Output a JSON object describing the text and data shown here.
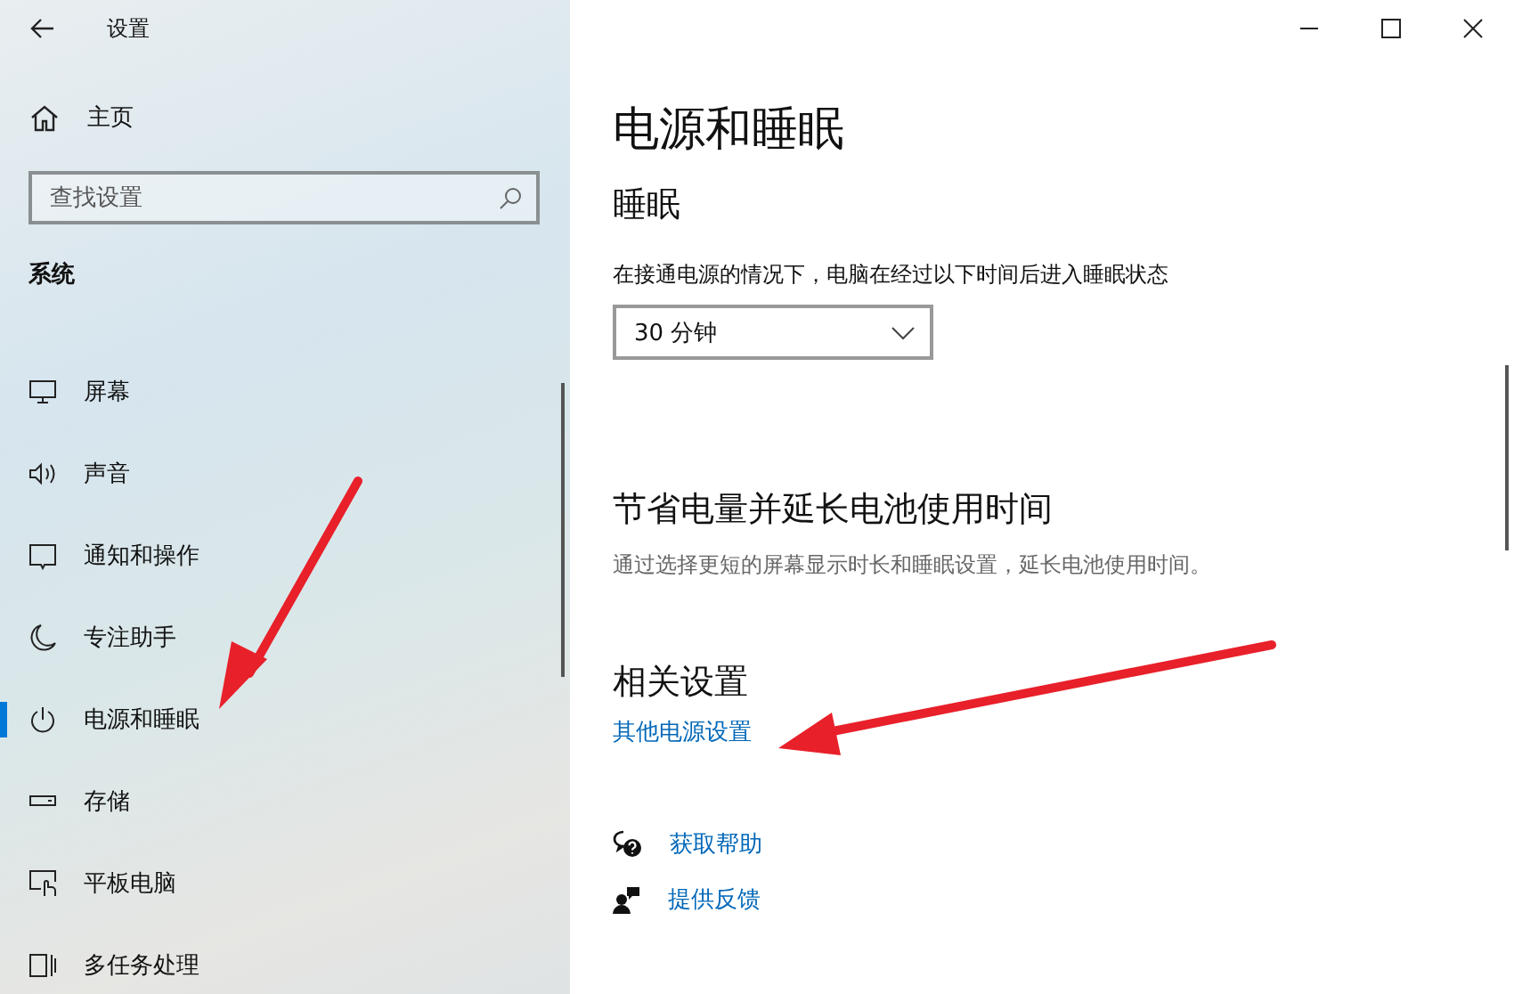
{
  "window": {
    "title": "设置"
  },
  "sidebar": {
    "home": "主页",
    "search": {
      "placeholder": "查找设置"
    },
    "section": "系统",
    "items": [
      {
        "label": "屏幕",
        "kind": "display",
        "selected": false
      },
      {
        "label": "声音",
        "kind": "sound",
        "selected": false
      },
      {
        "label": "通知和操作",
        "kind": "notify",
        "selected": false
      },
      {
        "label": "专注助手",
        "kind": "moon",
        "selected": false
      },
      {
        "label": "电源和睡眠",
        "kind": "power",
        "selected": true
      },
      {
        "label": "存储",
        "kind": "storage",
        "selected": false
      },
      {
        "label": "平板电脑",
        "kind": "tablet",
        "selected": false
      },
      {
        "label": "多任务处理",
        "kind": "multitask",
        "selected": false
      }
    ]
  },
  "page": {
    "title": "电源和睡眠",
    "sleep_heading": "睡眠",
    "sleep_label": "在接通电源的情况下，电脑在经过以下时间后进入睡眠状态",
    "sleep_value": "30 分钟",
    "battery_heading": "节省电量并延长电池使用时间",
    "battery_text": "通过选择更短的屏幕显示时长和睡眠设置，延长电池使用时间。",
    "related_heading": "相关设置",
    "related_link": "其他电源设置",
    "help_links": [
      {
        "label": "获取帮助",
        "kind": "help"
      },
      {
        "label": "提供反馈",
        "kind": "feedback"
      }
    ]
  }
}
